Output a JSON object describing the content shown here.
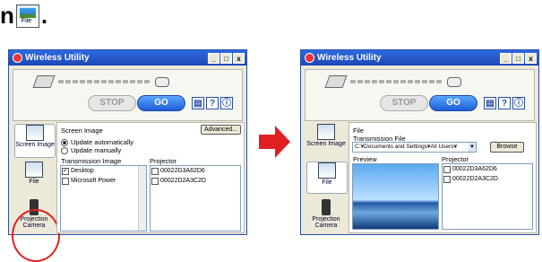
{
  "heading": {
    "text": "n",
    "dot": ".",
    "icon_caption": "File"
  },
  "window": {
    "title": "Wireless Utility",
    "min": "_",
    "max": "□",
    "close": "x"
  },
  "controls": {
    "stop": "STOP",
    "go": "GO",
    "doc_icon": "▤",
    "help": "?",
    "info": "ⓘ"
  },
  "sidebar": [
    {
      "label": "Screen Image"
    },
    {
      "label": "File"
    },
    {
      "label": "Projection Camera"
    }
  ],
  "screen_image": {
    "title": "Screen Image",
    "advanced": "Advanced...",
    "radio_auto": "Update automatically",
    "radio_manual": "Update manually",
    "transmission_label": "Transmission Image",
    "items": [
      "Desktop",
      "Microsoft Power"
    ],
    "projector_label": "Projector",
    "projectors": [
      "00022D3A62D6",
      "00022D2A3C2D"
    ]
  },
  "file_panel": {
    "title": "File",
    "transmission_label": "Transmission File",
    "path": "C:¥Documents and Settings¥All Users¥",
    "browse": "Browse",
    "preview_label": "Preview",
    "projector_label": "Projector",
    "projectors": [
      "00022D3A62D6",
      "00022D2A3C2D"
    ]
  },
  "colors": {
    "accent": "#2d6ae0",
    "highlight": "#e02020"
  }
}
